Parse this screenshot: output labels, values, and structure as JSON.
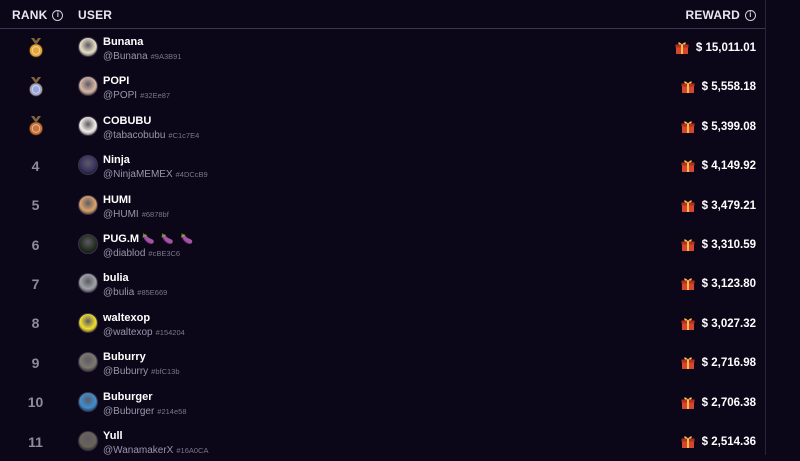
{
  "header": {
    "rank_label": "RANK",
    "user_label": "USER",
    "reward_label": "REWARD",
    "info_glyph": "i"
  },
  "rows": [
    {
      "rank": "",
      "medal": "gold",
      "name": "Bunana",
      "handle": "@Bunana",
      "id": "#9A3B91",
      "reward": "$ 15,011.01",
      "avatar_color": "#e7dfc4"
    },
    {
      "rank": "",
      "medal": "silver",
      "name": "POPI",
      "handle": "@POPI",
      "id": "#32Ee87",
      "reward": "$ 5,558.18",
      "avatar_color": "#d7b8a5"
    },
    {
      "rank": "",
      "medal": "bronze",
      "name": "COBUBU",
      "handle": "@tabacobubu",
      "id": "#C1c7E4",
      "reward": "$ 5,399.08",
      "avatar_color": "#f2efe8"
    },
    {
      "rank": "4",
      "medal": "",
      "name": "Ninja",
      "handle": "@NinjaMEMEX",
      "id": "#4DCcB9",
      "reward": "$ 4,149.92",
      "avatar_color": "#3a3360"
    },
    {
      "rank": "5",
      "medal": "",
      "name": "HUMI",
      "handle": "@HUMI",
      "id": "#6878bf",
      "reward": "$ 3,479.21",
      "avatar_color": "#d9a36a"
    },
    {
      "rank": "6",
      "medal": "",
      "name": "PUG.M",
      "handle": "@diablod",
      "id": "#cBE3C6",
      "reward": "$ 3,310.59",
      "avatar_color": "#253020",
      "emoji": "🍆 🍆 🍆"
    },
    {
      "rank": "7",
      "medal": "",
      "name": "bulia",
      "handle": "@bulia",
      "id": "#85E669",
      "reward": "$ 3,123.80",
      "avatar_color": "#9fa4a8"
    },
    {
      "rank": "8",
      "medal": "",
      "name": "waltexop",
      "handle": "@waltexop",
      "id": "#154204",
      "reward": "$ 3,027.32",
      "avatar_color": "#f1e02e"
    },
    {
      "rank": "9",
      "medal": "",
      "name": "Buburry",
      "handle": "@Buburry",
      "id": "#bfC13b",
      "reward": "$ 2,716.98",
      "avatar_color": "#7c7a6e"
    },
    {
      "rank": "10",
      "medal": "",
      "name": "Buburger",
      "handle": "@Buburger",
      "id": "#214e58",
      "reward": "$ 2,706.38",
      "avatar_color": "#3f8fd1"
    },
    {
      "rank": "11",
      "medal": "",
      "name": "Yull",
      "handle": "@WanamakerX",
      "id": "#16A0CA",
      "reward": "$ 2,514.36",
      "avatar_color": "#6a6458"
    }
  ],
  "colors": {
    "background": "#0c0718",
    "gold": "#e3a63a",
    "silver": "#9aa6d8",
    "bronze": "#c9733b",
    "gift": "#d8452f"
  }
}
